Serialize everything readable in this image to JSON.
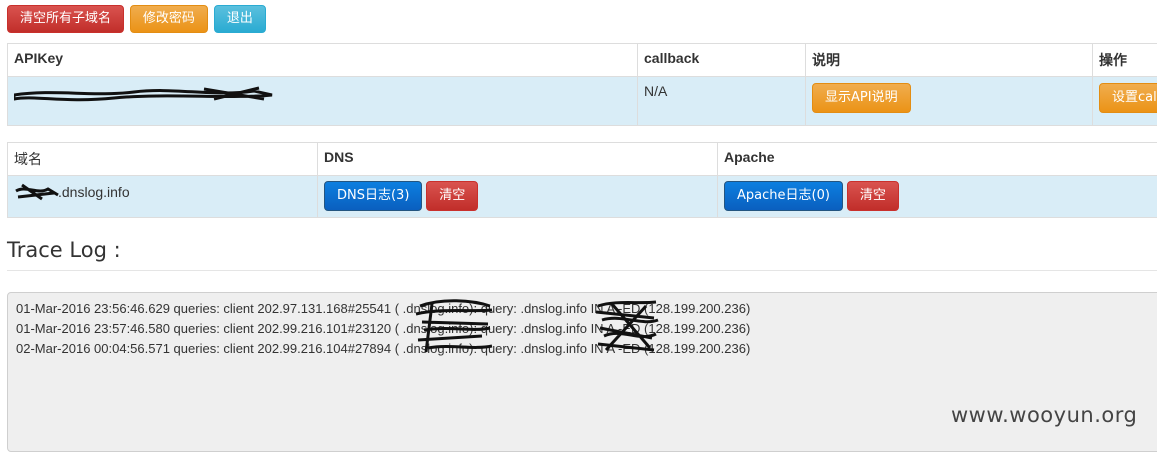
{
  "toolbar": {
    "clear_all_label": "清空所有子域名",
    "change_password_label": "修改密码",
    "logout_label": "退出"
  },
  "api_table": {
    "headers": [
      "APIKey",
      "callback",
      "说明",
      "操作"
    ],
    "row": {
      "apikey": "",
      "callback": "N/A",
      "show_api_doc_label": "显示API说明",
      "set_callback_label": "设置callback"
    }
  },
  "dns_table": {
    "headers": [
      "域名",
      "DNS",
      "Apache"
    ],
    "row": {
      "domain_suffix": ".dnslog.info",
      "dns_log_label": "DNS日志(3)",
      "dns_clear_label": "清空",
      "apache_log_label": "Apache日志(0)",
      "apache_clear_label": "清空"
    }
  },
  "trace": {
    "title": "Trace Log :",
    "lines": [
      "01-Mar-2016 23:56:46.629 queries: client 202.97.131.168#25541 (        .dnslog.info): query:        .dnslog.info IN A -ED (128.199.200.236)",
      "01-Mar-2016 23:57:46.580 queries: client 202.99.216.101#23120 (        .dnslog.info): query:        .dnslog.info IN A -ED (128.199.200.236)",
      "02-Mar-2016 00:04:56.571 queries: client 202.99.216.104#27894 (        .dnslog.info): query:        .dnslog.info IN A -ED (128.199.200.236)"
    ]
  },
  "watermark": "www.wooyun.org",
  "colors": {
    "danger": "#d9534f",
    "warning": "#f0ad4e",
    "info": "#5bc0de",
    "primary": "#0a6fd0",
    "row_highlight": "#d9edf7"
  }
}
